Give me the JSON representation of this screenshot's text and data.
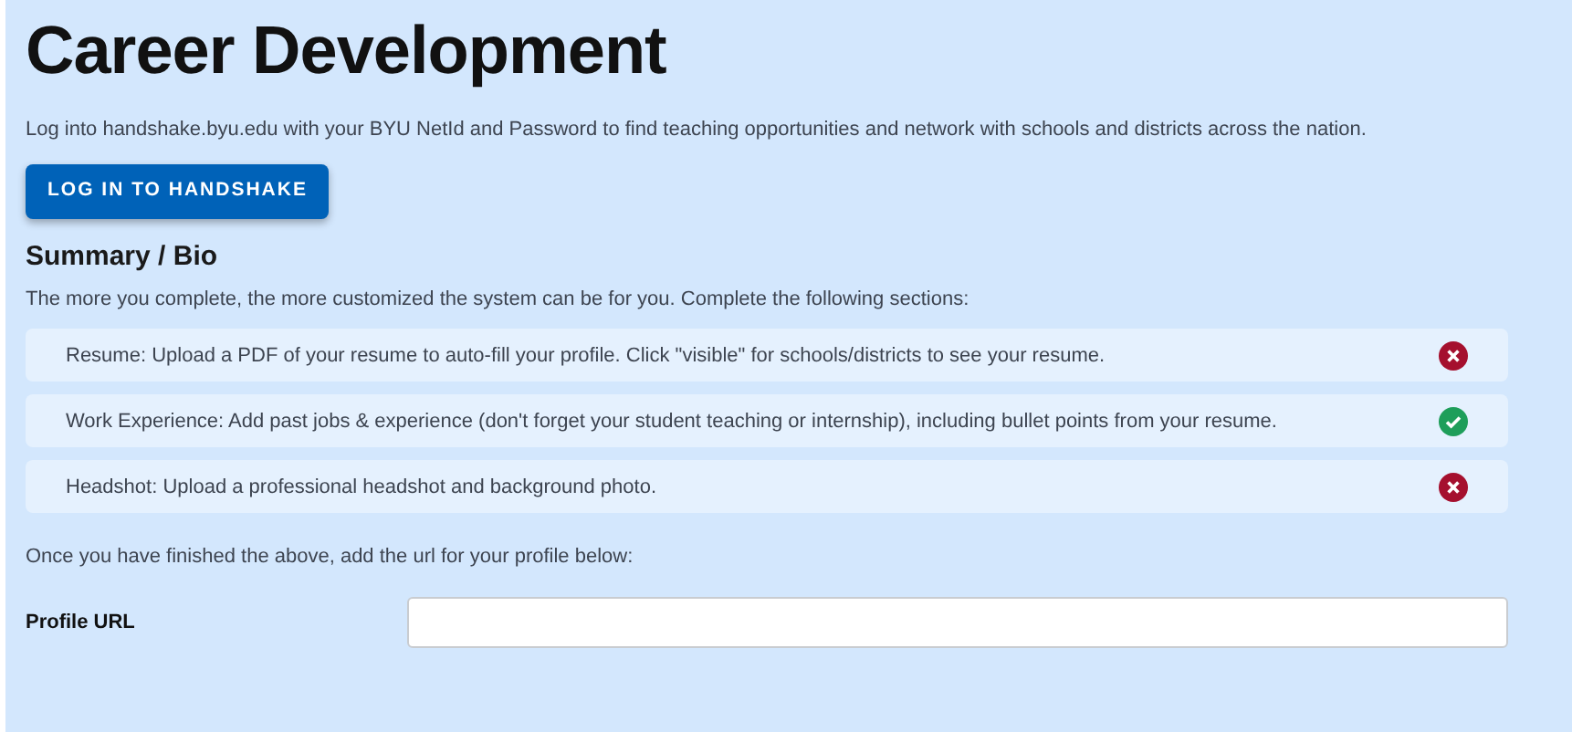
{
  "title": "Career Development",
  "intro": "Log into handshake.byu.edu with your BYU NetId and Password to find teaching opportunities and network with schools and districts across the nation.",
  "login_button": "LOG IN TO HANDSHAKE",
  "section_title": "Summary / Bio",
  "section_intro": "The more you complete, the more customized the system can be for you. Complete the following sections:",
  "checklist": [
    {
      "text": "Resume: Upload a PDF of your resume to auto-fill your profile. Click \"visible\" for schools/districts to see your resume.",
      "complete": false
    },
    {
      "text": "Work Experience: Add past jobs & experience (don't forget your student teaching or internship), including bullet points from your resume.",
      "complete": true
    },
    {
      "text": "Headshot: Upload a professional headshot and background photo.",
      "complete": false
    }
  ],
  "after_note": "Once you have finished the above, add the url for your profile below:",
  "profile_url": {
    "label": "Profile URL"
  }
}
